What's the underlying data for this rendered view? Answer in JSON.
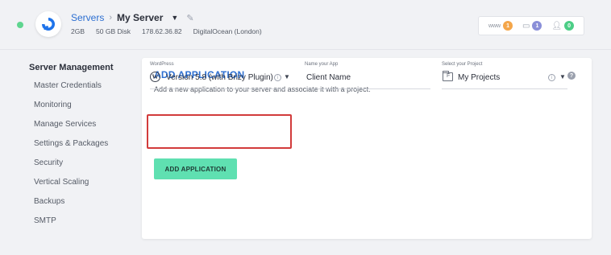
{
  "header": {
    "breadcrumb_root": "Servers",
    "breadcrumb_sep": "›",
    "server_name": "My Server",
    "meta": [
      "2GB",
      "50 GB Disk",
      "178.62.36.82",
      "DigitalOcean (London)"
    ],
    "stats": [
      {
        "label": "www",
        "count": "1",
        "color": "#f4a64a"
      },
      {
        "label": "",
        "count": "1",
        "color": "#8a8fd8"
      },
      {
        "label": "",
        "count": "0",
        "color": "#4cce86"
      }
    ],
    "status_color": "#5fd58f"
  },
  "sidebar": {
    "title": "Server Management",
    "items": [
      {
        "label": "Master Credentials"
      },
      {
        "label": "Monitoring"
      },
      {
        "label": "Manage Services"
      },
      {
        "label": "Settings & Packages"
      },
      {
        "label": "Security"
      },
      {
        "label": "Vertical Scaling"
      },
      {
        "label": "Backups"
      },
      {
        "label": "SMTP"
      }
    ]
  },
  "main": {
    "title": "ADD APPLICATION",
    "description": "Add a new application to your server and associate it with a project.",
    "help_glyph": "?",
    "fields": {
      "application": {
        "label": "WordPress",
        "value": "Version 5.8 (with Brizy Plugin)"
      },
      "app_name": {
        "label": "Name your App",
        "value": "Client Name"
      },
      "project": {
        "label": "Select your Project",
        "value": "My Projects"
      }
    },
    "submit_label": "ADD APPLICATION",
    "accent_color": "#2d6fd1",
    "button_color": "#5fe0b1",
    "highlight_color": "#d23b3b"
  }
}
